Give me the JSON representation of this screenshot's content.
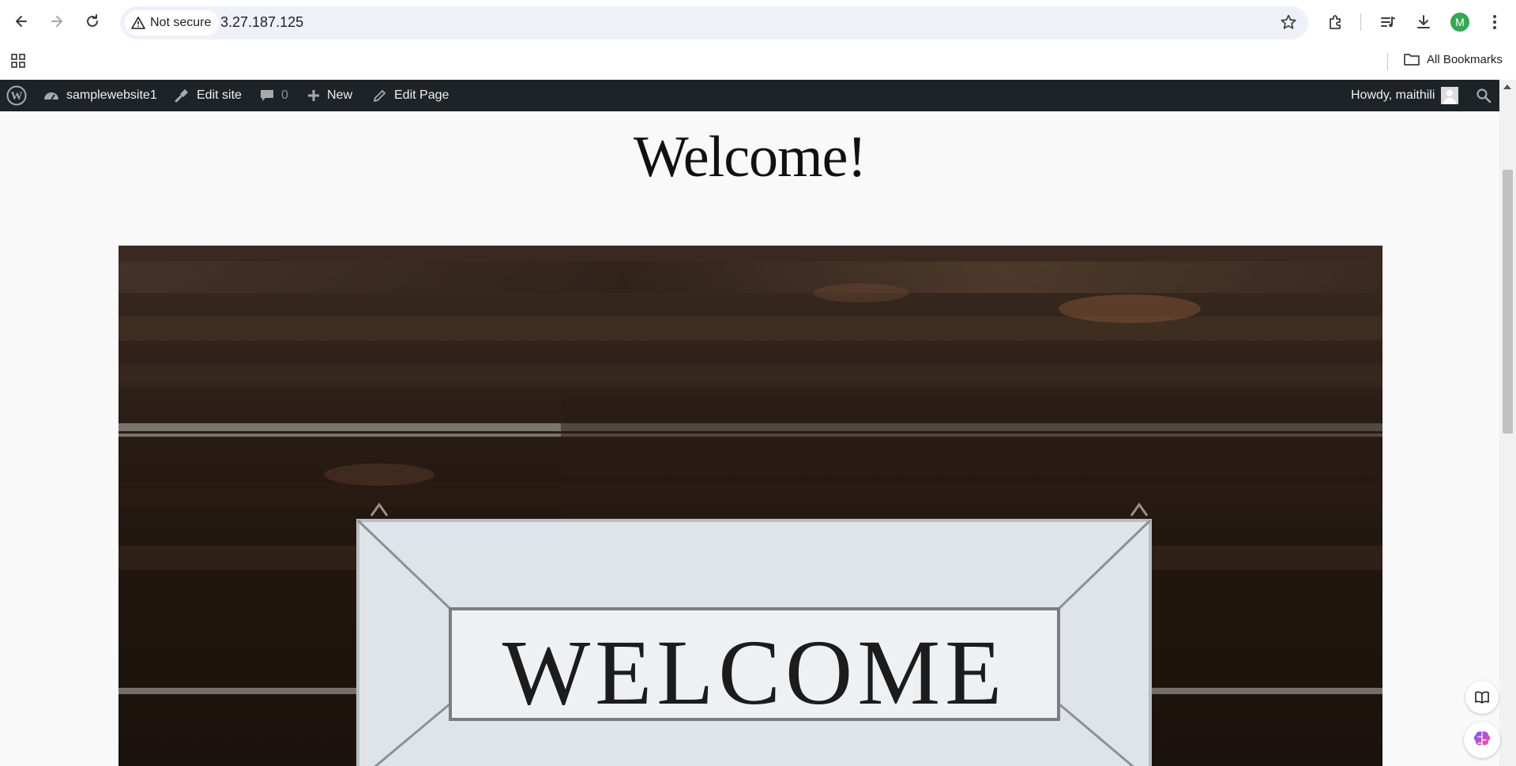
{
  "browser": {
    "security_label": "Not secure",
    "url": "3.27.187.125",
    "profile_initial": "M",
    "all_bookmarks_label": "All Bookmarks"
  },
  "admin_bar": {
    "site_name": "samplewebsite1",
    "edit_site_label": "Edit site",
    "comments_count": "0",
    "new_label": "New",
    "edit_page_label": "Edit Page",
    "greeting": "Howdy, maithili"
  },
  "page": {
    "title": "Welcome!",
    "hero_sign_text": "WELCOME"
  },
  "colors": {
    "admin_bar_bg": "#1d2327",
    "profile_green": "#34a853",
    "omnibox_bg": "#eef1f8"
  },
  "icons": [
    "back-icon",
    "forward-icon",
    "reload-icon",
    "warning-icon",
    "star-icon",
    "extensions-icon",
    "media-icon",
    "download-icon",
    "more-icon",
    "apps-icon",
    "folder-icon",
    "wordpress-logo-icon",
    "dashboard-icon",
    "brush-icon",
    "comment-icon",
    "plus-icon",
    "pencil-icon",
    "user-avatar-icon",
    "search-icon",
    "reader-icon",
    "ai-assistant-icon"
  ]
}
